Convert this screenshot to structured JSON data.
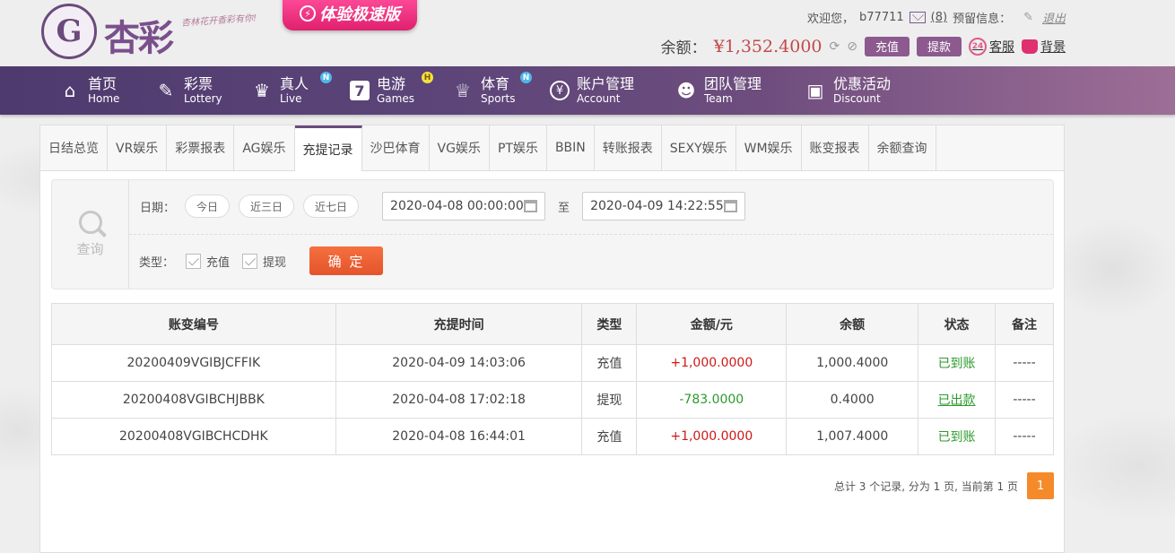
{
  "brand": {
    "mark": "G",
    "name": "杏彩",
    "slogan": "杏林花开香彩有你!"
  },
  "promo": {
    "label": "体验极速版",
    "icon": "lightning-icon"
  },
  "user": {
    "welcome": "欢迎您，",
    "username": "b77711",
    "messages": "(8)",
    "notice_label": "预留信息：",
    "logout": "退出"
  },
  "balance": {
    "label": "余额：",
    "value": "¥1,352.4000",
    "deposit": "充值",
    "withdraw": "提款",
    "service": "客服",
    "service_badge": "24",
    "background": "背景"
  },
  "nav": [
    {
      "cn": "首页",
      "en": "Home",
      "icon": "home-icon"
    },
    {
      "cn": "彩票",
      "en": "Lottery",
      "icon": "ticket-icon"
    },
    {
      "cn": "真人",
      "en": "Live",
      "icon": "dealer-icon",
      "badge": "N"
    },
    {
      "cn": "电游",
      "en": "Games",
      "icon": "slot-icon",
      "badge": "H"
    },
    {
      "cn": "体育",
      "en": "Sports",
      "icon": "trophy-icon",
      "badge": "N"
    },
    {
      "cn": "账户管理",
      "en": "Account",
      "icon": "yen-icon"
    },
    {
      "cn": "团队管理",
      "en": "Team",
      "icon": "team-icon"
    },
    {
      "cn": "优惠活动",
      "en": "Discount",
      "icon": "gift-icon"
    }
  ],
  "tabs": [
    "日结总览",
    "VR娱乐",
    "彩票报表",
    "AG娱乐",
    "充提记录",
    "沙巴体育",
    "VG娱乐",
    "PT娱乐",
    "BBIN",
    "转账报表",
    "SEXY娱乐",
    "WM娱乐",
    "账变报表",
    "余额查询"
  ],
  "active_tab": "充提记录",
  "filter": {
    "query_label": "查询",
    "date_label": "日期：",
    "quick": [
      "今日",
      "近三日",
      "近七日"
    ],
    "start": "2020-04-08 00:00:00",
    "to": "至",
    "end": "2020-04-09 14:22:55",
    "type_label": "类型：",
    "types": [
      "充值",
      "提现"
    ],
    "confirm": "确 定"
  },
  "table": {
    "headers": [
      "账变编号",
      "充提时间",
      "类型",
      "金额/元",
      "余额",
      "状态",
      "备注"
    ],
    "rows": [
      {
        "id": "20200409VGIBJCFFIK",
        "time": "2020-04-09 14:03:06",
        "type": "充值",
        "amount": "+1,000.0000",
        "balance": "1,000.4000",
        "status": "已到账",
        "note": "-----"
      },
      {
        "id": "20200408VGIBCHJBBK",
        "time": "2020-04-08 17:02:18",
        "type": "提现",
        "amount": "-783.0000",
        "balance": "0.4000",
        "status": "已出款",
        "note": "-----"
      },
      {
        "id": "20200408VGIBCHCDHK",
        "time": "2020-04-08 16:44:01",
        "type": "充值",
        "amount": "+1,000.0000",
        "balance": "1,007.4000",
        "status": "已到账",
        "note": "-----"
      }
    ]
  },
  "pager": {
    "summary": "总计 3 个记录, 分为 1 页, 当前第 1 页",
    "current": "1"
  }
}
